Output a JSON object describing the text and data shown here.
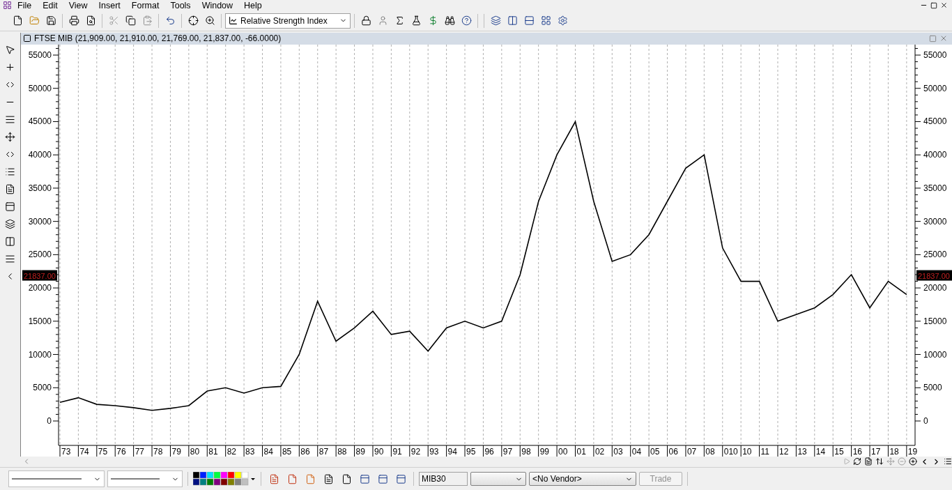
{
  "menu": [
    "File",
    "Edit",
    "View",
    "Insert",
    "Format",
    "Tools",
    "Window",
    "Help"
  ],
  "toolbar": {
    "indicator": "Relative Strength Index"
  },
  "chart_window": {
    "title": "(21,909.00, 21,910.00, 21,769.00, 21,837.00, -66.0000)",
    "price_tags": [
      "21837.00",
      "21837.00"
    ],
    "left_axis_labels": [
      "55000",
      "50000",
      "45000",
      "40000",
      "35000",
      "30000",
      "25000",
      "20000",
      "15000",
      "10000",
      "5000",
      "0"
    ],
    "chart_data": {
      "type": "line",
      "categories": [
        "73",
        "74",
        "75",
        "76",
        "77",
        "78",
        "79",
        "80",
        "81",
        "82",
        "83",
        "84",
        "85",
        "86",
        "87",
        "88",
        "89",
        "90",
        "91",
        "92",
        "93",
        "94",
        "95",
        "96",
        "97",
        "98",
        "99",
        "00",
        "01",
        "02",
        "03",
        "04",
        "05",
        "06",
        "07",
        "08",
        "010",
        "10",
        "11",
        "12",
        "13",
        "14",
        "15",
        "16",
        "17",
        "18",
        "19"
      ],
      "series": [
        {
          "name": "FTSE MIB",
          "color": "#000000",
          "values": [
            2800,
            3500,
            2500,
            2300,
            2000,
            1600,
            1900,
            2300,
            4500,
            5000,
            4200,
            5000,
            5200,
            10000,
            18000,
            12000,
            14000,
            16500,
            13000,
            13500,
            10500,
            14000,
            15000,
            14000,
            15000,
            22000,
            33000,
            40000,
            45000,
            33000,
            24000,
            25000,
            28000,
            33000,
            38000,
            40000,
            26000,
            21000,
            21000,
            15000,
            16000,
            17000,
            19000,
            22000,
            17000,
            21000,
            19000
          ]
        }
      ],
      "ylim": [
        -3667,
        56574
      ],
      "yticks": [
        0,
        5000,
        10000,
        15000,
        20000,
        25000,
        30000,
        35000,
        40000,
        45000,
        50000,
        55000
      ]
    }
  },
  "bottom_bar": {
    "symbol": "MIB30",
    "vendor": "<No Vendor>",
    "trade_button": {
      "label": "Trade",
      "disabled": true
    }
  }
}
